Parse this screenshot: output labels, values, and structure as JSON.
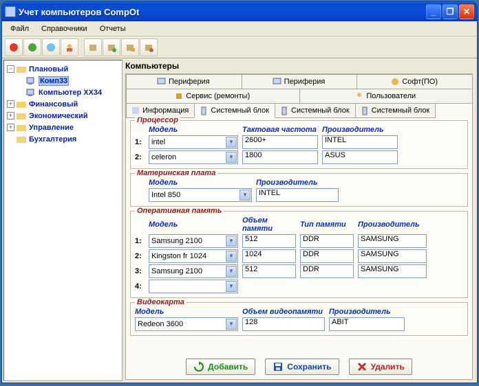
{
  "window": {
    "title": "Учет компьютеров CompOt"
  },
  "menu": {
    "file": "Файл",
    "dicts": "Справочники",
    "reports": "Отчеты"
  },
  "tree": {
    "n0": "Плановый",
    "n0a": "Комп33",
    "n0b": "Компьютер XX34",
    "n1": "Финансовый",
    "n2": "Экономический",
    "n3": "Управление",
    "n4": "Бухгалтерия"
  },
  "section_title": "Компьютеры",
  "tabs": {
    "r1a": "Периферия",
    "r1b": "Периферия",
    "r1c": "Софт(ПО)",
    "r2a": "Сервис (ремонты)",
    "r2b": "Пользователи",
    "r3a": "Информация",
    "r3b": "Системный блок",
    "r3c": "Системный блок",
    "r3d": "Системный блок"
  },
  "cpu": {
    "title": "Процессор",
    "h_model": "Модель",
    "h_freq": "Тактовая частота",
    "h_maker": "Производитель",
    "r1_model": "intel",
    "r1_freq": "2600+",
    "r1_maker": "INTEL",
    "r2_model": "celeron",
    "r2_freq": "1800",
    "r2_maker": "ASUS",
    "n1": "1:",
    "n2": "2:"
  },
  "mb": {
    "title": "Материнская плата",
    "h_model": "Модель",
    "h_maker": "Производитель",
    "model": "Intel 850",
    "maker": "INTEL"
  },
  "ram": {
    "title": "Оперативная память",
    "h_model": "Модель",
    "h_size": "Объем памяти",
    "h_type": "Тип памяти",
    "h_maker": "Производитель",
    "r1_model": "Samsung 2100",
    "r1_size": "512",
    "r1_type": "DDR",
    "r1_maker": "SAMSUNG",
    "r2_model": "Kingston fr 1024",
    "r2_size": "1024",
    "r2_type": "DDR",
    "r2_maker": "SAMSUNG",
    "r3_model": "Samsung 2100",
    "r3_size": "512",
    "r3_type": "DDR",
    "r3_maker": "SAMSUNG",
    "r4_model": "",
    "n1": "1:",
    "n2": "2:",
    "n3": "3:",
    "n4": "4:"
  },
  "gpu": {
    "title": "Видеокарта",
    "h_model": "Модель",
    "h_size": "Объем видеопамяти",
    "h_maker": "Производитель",
    "model": "Redeon 3600",
    "size": "128",
    "maker": "ABIT"
  },
  "buttons": {
    "add": "Добавить",
    "save": "Сохранить",
    "delete": "Удалить"
  }
}
